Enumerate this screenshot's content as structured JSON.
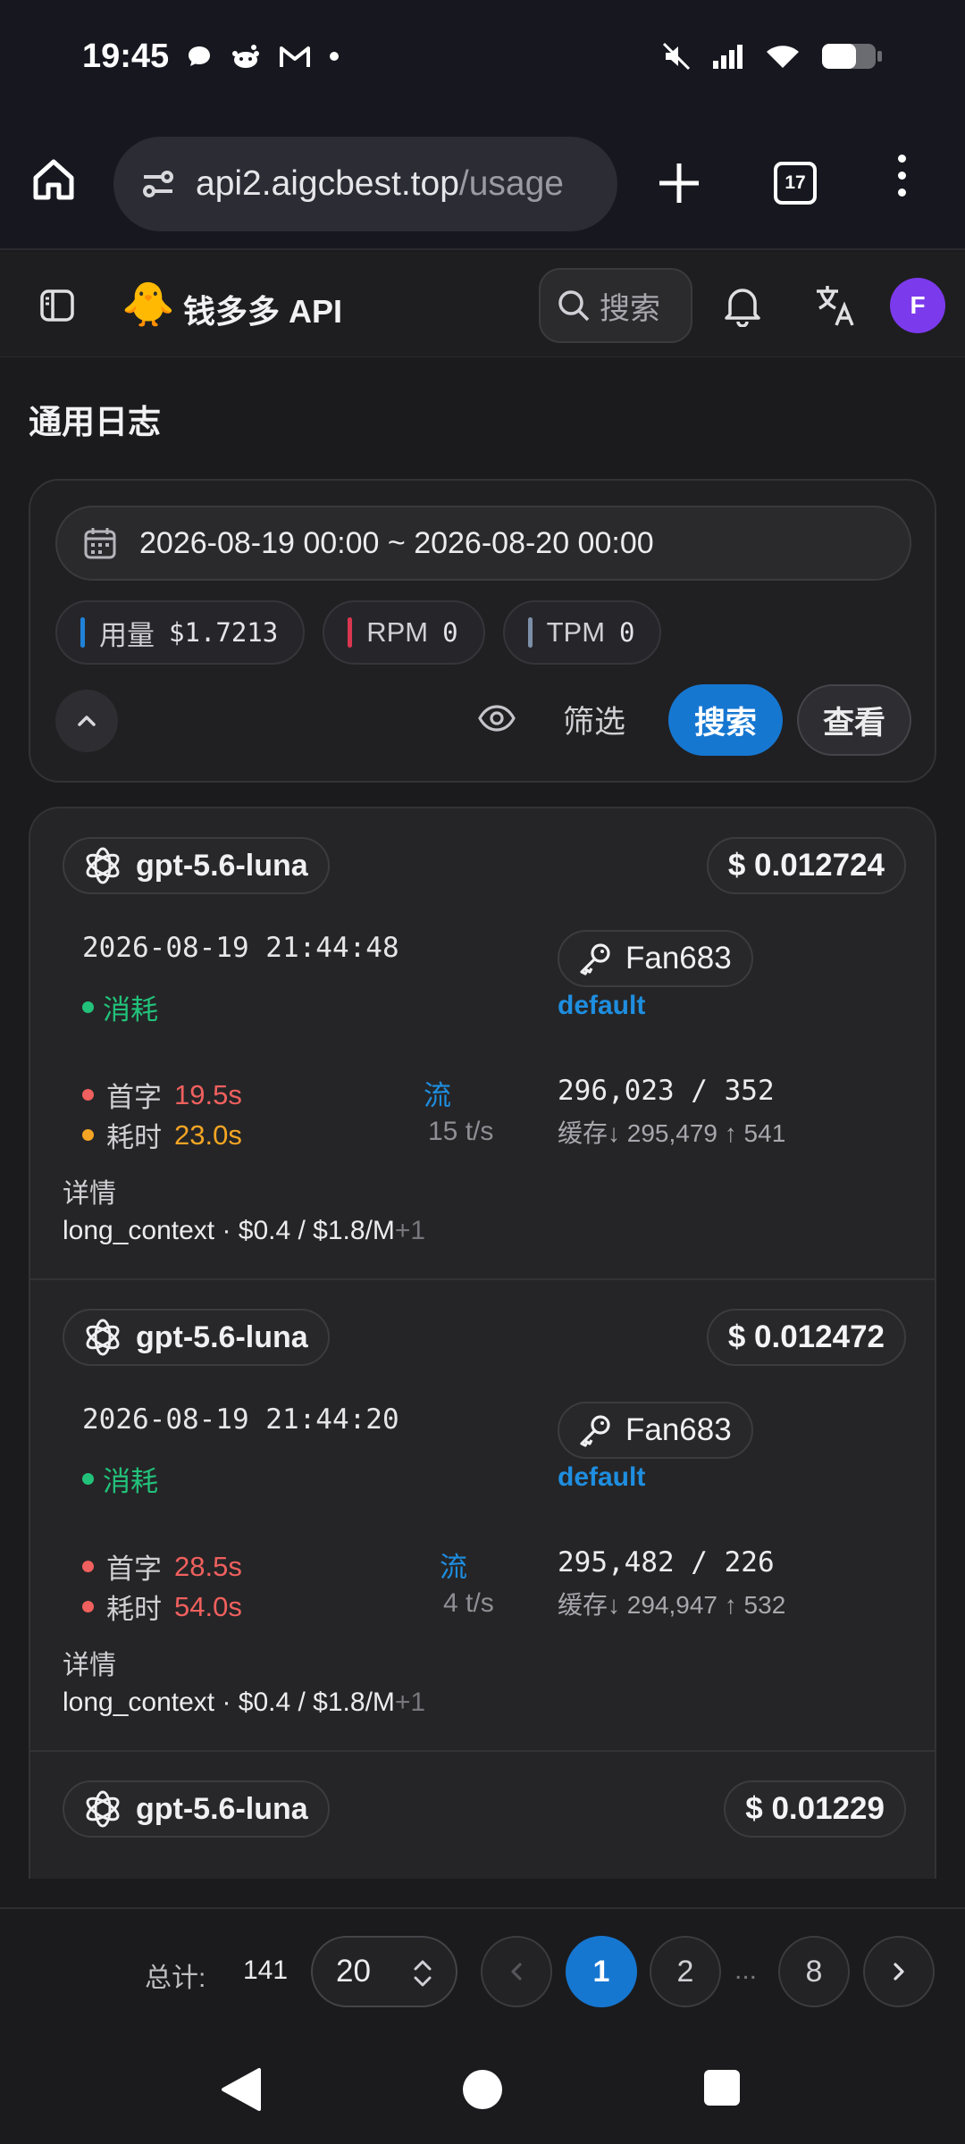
{
  "status_bar": {
    "time": "19:45"
  },
  "browser": {
    "url_host": "api2.aigcbest.top",
    "url_path": "/usage",
    "tab_count": "17"
  },
  "header": {
    "logo_emoji": "🐥",
    "title": "钱多多 API",
    "search_label": "搜索",
    "avatar_letter": "F"
  },
  "page": {
    "title": "通用日志"
  },
  "filters": {
    "date_range": "2026-08-19 00:00 ~ 2026-08-20 00:00",
    "stats": [
      {
        "label": "用量",
        "value": "$1.7213",
        "color": "#1f82d8"
      },
      {
        "label": "RPM",
        "value": "0",
        "color": "#d9364f"
      },
      {
        "label": "TPM",
        "value": "0",
        "color": "#7c8fa8"
      }
    ],
    "filter_label": "筛选",
    "search_label": "搜索",
    "view_label": "查看"
  },
  "logs": [
    {
      "model": "gpt-5.6-luna",
      "cost": "$ 0.012724",
      "time": "2026-08-19 21:44:48",
      "status": "消耗",
      "token": "Fan683",
      "group": "default",
      "first_label": "首字",
      "first_value": "19.5s",
      "first_color": "#f0605e",
      "dur_label": "耗时",
      "dur_value": "23.0s",
      "dur_color": "#f5a524",
      "stream": "流",
      "tps": "15 t/s",
      "tokens": "296,023 / 352",
      "cache": "缓存↓ 295,479  ↑ 541",
      "detail_label": "详情",
      "detail": "long_context · $0.4 / $1.8/M",
      "detail_more": "+1"
    },
    {
      "model": "gpt-5.6-luna",
      "cost": "$ 0.012472",
      "time": "2026-08-19 21:44:20",
      "status": "消耗",
      "token": "Fan683",
      "group": "default",
      "first_label": "首字",
      "first_value": "28.5s",
      "first_color": "#f0605e",
      "dur_label": "耗时",
      "dur_value": "54.0s",
      "dur_color": "#f0605e",
      "stream": "流",
      "tps": "4 t/s",
      "tokens": "295,482 / 226",
      "cache": "缓存↓ 294,947  ↑ 532",
      "detail_label": "详情",
      "detail": "long_context · $0.4 / $1.8/M",
      "detail_more": "+1"
    },
    {
      "model": "gpt-5.6-luna",
      "cost": "$ 0.01229"
    }
  ],
  "pagination": {
    "total_label": "总计:",
    "total": "141",
    "page_size": "20",
    "pages": [
      "1",
      "2",
      "8"
    ],
    "ellipsis": "...",
    "current": "1"
  }
}
